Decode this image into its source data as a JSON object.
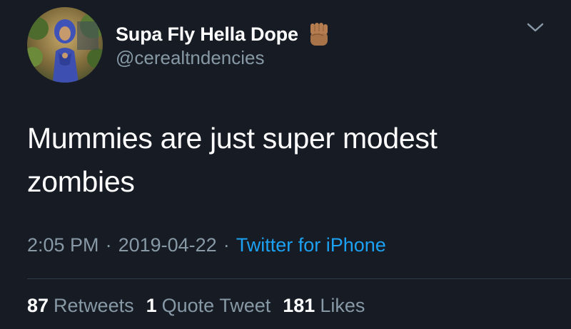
{
  "tweet": {
    "display_name": "Supa Fly Hella Dope",
    "badge_icon": "raised-fist-icon",
    "handle": "@cerealtndencies",
    "text_line1": "Mummies are just super modest",
    "text_line2": "zombies",
    "time": "2:05 PM",
    "separator": "·",
    "date": "2019-04-22",
    "source": "Twitter for iPhone",
    "stats": {
      "retweets_count": "87",
      "retweets_label": "Retweets",
      "quotes_count": "1",
      "quotes_label": "Quote Tweet",
      "likes_count": "181",
      "likes_label": "Likes"
    }
  },
  "colors": {
    "background": "#161b24",
    "primary_text": "#ffffff",
    "secondary_text": "#8899a6",
    "link": "#1da1f2",
    "divider": "#2f3b47"
  }
}
